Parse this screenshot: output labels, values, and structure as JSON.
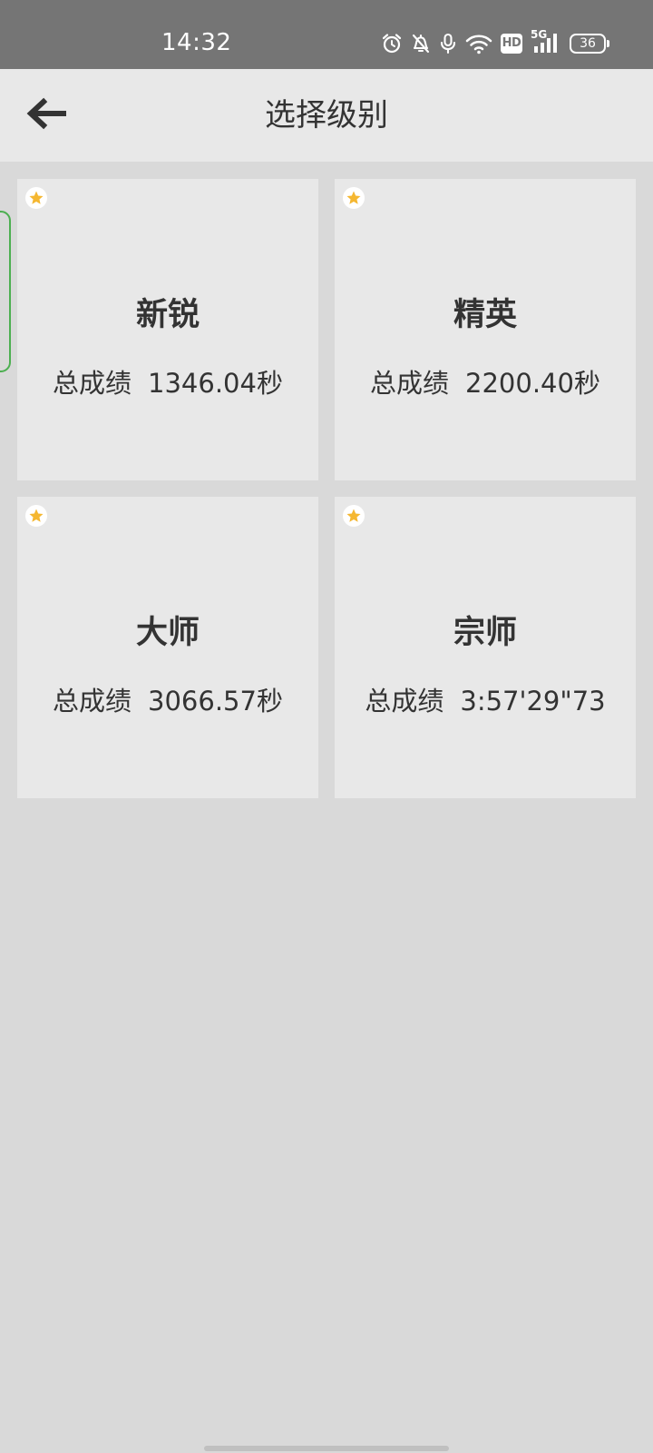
{
  "status_bar": {
    "time": "14:32",
    "network": "5G",
    "hd_label": "HD",
    "battery_level": "36",
    "icons": [
      "alarm-icon",
      "bell-off-icon",
      "microphone-icon",
      "wifi-icon",
      "hd-icon",
      "signal-5g-icon",
      "battery-icon"
    ]
  },
  "header": {
    "title": "选择级别",
    "back_icon": "arrow-left-icon"
  },
  "levels": [
    {
      "name": "新锐",
      "score_label": "总成绩",
      "score_value": "1346.04秒",
      "starred": true
    },
    {
      "name": "精英",
      "score_label": "总成绩",
      "score_value": "2200.40秒",
      "starred": true
    },
    {
      "name": "大师",
      "score_label": "总成绩",
      "score_value": "3066.57秒",
      "starred": true
    },
    {
      "name": "宗师",
      "score_label": "总成绩",
      "score_value": "3:57'29\"73",
      "starred": true
    }
  ],
  "colors": {
    "status_bar_bg": "#757575",
    "app_bar_bg": "#e8e8e8",
    "page_bg": "#d9d9d9",
    "card_bg": "#e8e8e8",
    "text": "#333333",
    "star": "#f5b731",
    "edge_handle": "#4caf50"
  }
}
